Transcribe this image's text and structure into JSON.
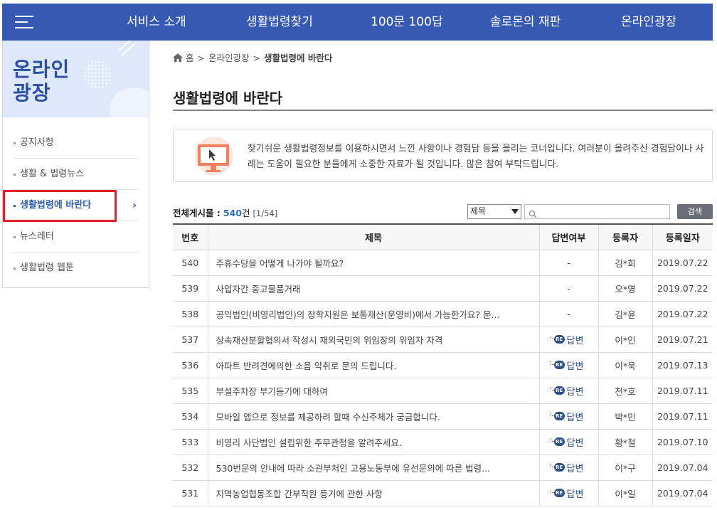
{
  "topnav": {
    "menu_icon": "hamburger-icon",
    "items": [
      "서비스 소개",
      "생활법령찾기",
      "100문 100답",
      "솔로몬의 재판",
      "온라인광장"
    ]
  },
  "sidebar": {
    "title_line1": "온라인",
    "title_line2": "광장",
    "items": [
      {
        "label": "공지사항"
      },
      {
        "label": "생활 & 법령뉴스"
      },
      {
        "label": "생활법령에 바란다"
      },
      {
        "label": "뉴스레터"
      },
      {
        "label": "생활법령 웹툰"
      }
    ],
    "active_index": 2,
    "active_icon": "chevron-right-icon"
  },
  "breadcrumb": {
    "home_icon": "home-icon",
    "home": "홈",
    "parent": "온라인광장",
    "current": "생활법령에 바란다"
  },
  "page": {
    "title": "생활법령에 바란다",
    "info_icon": "monitor-cursor-icon",
    "info_text": "찾기쉬운 생활법령정보를 이용하시면서 느낀 사항이나 경험담 등을 올리는 코너입니다. 여러분이 올려주신 경험담이나 사례는 도움이 필요한 분들에게 소중한 자료가 될 것입니다. 많은 참여 부탁드립니다."
  },
  "list": {
    "total_label": "전체게시물 :",
    "total_count": "540",
    "total_unit": "건",
    "page_info": "[1/54]",
    "search_select": "제목",
    "search_placeholder": "",
    "search_icon": "search-icon",
    "search_button": "검색",
    "columns": [
      "번호",
      "제목",
      "답변여부",
      "등록자",
      "등록일자"
    ],
    "rows": [
      {
        "no": "540",
        "title": "주휴수당을 어떻게 나가야 될까요?",
        "answer": "-",
        "writer": "김*희",
        "date": "2019.07.22"
      },
      {
        "no": "539",
        "title": "사업자간 중고물품거래",
        "answer": "-",
        "writer": "오*영",
        "date": "2019.07.22"
      },
      {
        "no": "538",
        "title": "공익법인(비영리법인)의 장학지원은 보통재산(운영비)에서 가능한가요? 문...",
        "answer": "-",
        "writer": "김*윤",
        "date": "2019.07.22"
      },
      {
        "no": "537",
        "title": "상속재산분할협의서 작성시 재외국민의 위임장의 위임자 자격",
        "answer": "답변",
        "writer": "이*인",
        "date": "2019.07.21"
      },
      {
        "no": "536",
        "title": "아파트 반려견에의한 소음 악취로 문의 드립니다.",
        "answer": "답변",
        "writer": "이*욱",
        "date": "2019.07.13"
      },
      {
        "no": "535",
        "title": "부설주차장 부기등기에 대하여",
        "answer": "답변",
        "writer": "천*호",
        "date": "2019.07.11"
      },
      {
        "no": "534",
        "title": "모바일 앱으로 정보를 제공하려 할때 수신주체가 궁금합니다.",
        "answer": "답변",
        "writer": "박*민",
        "date": "2019.07.11"
      },
      {
        "no": "533",
        "title": "비영리 사단법인 설립위한 주무관청을 알려주세요.",
        "answer": "답변",
        "writer": "황*철",
        "date": "2019.07.10"
      },
      {
        "no": "532",
        "title": "530번문의 안내에 따라 소관부처인 고용노동부에 유선문의에 따른 법령...",
        "answer": "답변",
        "writer": "이*구",
        "date": "2019.07.04"
      },
      {
        "no": "531",
        "title": "지역농업협동조합 간부직원 등기에 관한 사항",
        "answer": "답변",
        "writer": "이*일",
        "date": "2019.07.04"
      }
    ],
    "answer_badge": "RE",
    "answer_icon": "reply-re-icon"
  }
}
